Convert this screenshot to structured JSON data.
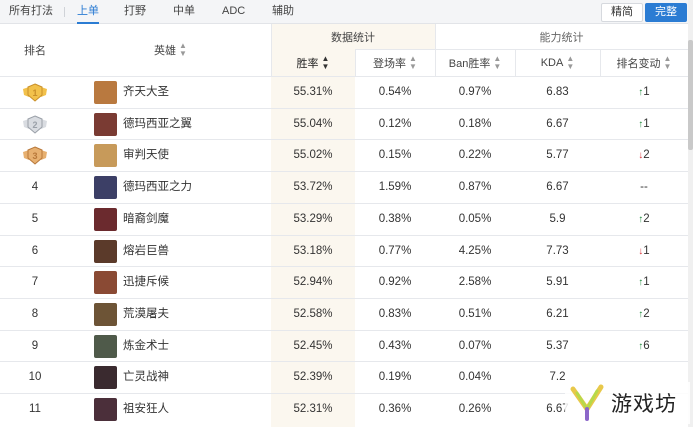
{
  "tabs": [
    {
      "label": "所有打法",
      "active": false
    },
    {
      "label": "上单",
      "active": true
    },
    {
      "label": "打野",
      "active": false
    },
    {
      "label": "中单",
      "active": false
    },
    {
      "label": "ADC",
      "active": false
    },
    {
      "label": "辅助",
      "active": false
    }
  ],
  "view_toggle": {
    "simple": "精简",
    "full": "完整",
    "selected": "完整"
  },
  "table": {
    "group_headers": {
      "data_stats": "数据统计",
      "ability_stats": "能力统计"
    },
    "columns": {
      "rank": "排名",
      "hero": "英雄",
      "winrate": "胜率",
      "pickrate": "登场率",
      "ban_winrate": "Ban胜率",
      "kda": "KDA",
      "rank_change": "排名变动"
    },
    "rows": [
      {
        "rank": "1",
        "medal": "gold-medal-icon",
        "hero": "齐天大圣",
        "avatar_color": "#b9793f",
        "winrate": "55.31%",
        "pickrate": "0.54%",
        "ban_winrate": "0.97%",
        "kda": "6.83",
        "change": "1",
        "direction": "up"
      },
      {
        "rank": "2",
        "medal": "silver-medal-icon",
        "hero": "德玛西亚之翼",
        "avatar_color": "#7a3b33",
        "winrate": "55.04%",
        "pickrate": "0.12%",
        "ban_winrate": "0.18%",
        "kda": "6.67",
        "change": "1",
        "direction": "up"
      },
      {
        "rank": "3",
        "medal": "bronze-medal-icon",
        "hero": "审判天使",
        "avatar_color": "#c79a5a",
        "winrate": "55.02%",
        "pickrate": "0.15%",
        "ban_winrate": "0.22%",
        "kda": "5.77",
        "change": "2",
        "direction": "down"
      },
      {
        "rank": "4",
        "medal": "",
        "hero": "德玛西亚之力",
        "avatar_color": "#3c3f66",
        "winrate": "53.72%",
        "pickrate": "1.59%",
        "ban_winrate": "0.87%",
        "kda": "6.67",
        "change": "--",
        "direction": "none"
      },
      {
        "rank": "5",
        "medal": "",
        "hero": "暗裔剑魔",
        "avatar_color": "#6b2a2e",
        "winrate": "53.29%",
        "pickrate": "0.38%",
        "ban_winrate": "0.05%",
        "kda": "5.9",
        "change": "2",
        "direction": "up"
      },
      {
        "rank": "6",
        "medal": "",
        "hero": "熔岩巨兽",
        "avatar_color": "#5b3a2a",
        "winrate": "53.18%",
        "pickrate": "0.77%",
        "ban_winrate": "4.25%",
        "kda": "7.73",
        "change": "1",
        "direction": "down"
      },
      {
        "rank": "7",
        "medal": "",
        "hero": "迅捷斥候",
        "avatar_color": "#8a4a34",
        "winrate": "52.94%",
        "pickrate": "0.92%",
        "ban_winrate": "2.58%",
        "kda": "5.91",
        "change": "1",
        "direction": "up"
      },
      {
        "rank": "8",
        "medal": "",
        "hero": "荒漠屠夫",
        "avatar_color": "#6d5436",
        "winrate": "52.58%",
        "pickrate": "0.83%",
        "ban_winrate": "0.51%",
        "kda": "6.21",
        "change": "2",
        "direction": "up"
      },
      {
        "rank": "9",
        "medal": "",
        "hero": "炼金术士",
        "avatar_color": "#4f5a4a",
        "winrate": "52.45%",
        "pickrate": "0.43%",
        "ban_winrate": "0.07%",
        "kda": "5.37",
        "change": "6",
        "direction": "up"
      },
      {
        "rank": "10",
        "medal": "",
        "hero": "亡灵战神",
        "avatar_color": "#3a2a2f",
        "winrate": "52.39%",
        "pickrate": "0.19%",
        "ban_winrate": "0.04%",
        "kda": "7.2",
        "change": "",
        "direction": "none"
      },
      {
        "rank": "11",
        "medal": "",
        "hero": "祖安狂人",
        "avatar_color": "#4b2f3a",
        "winrate": "52.31%",
        "pickrate": "0.36%",
        "ban_winrate": "0.26%",
        "kda": "6.67",
        "change": "",
        "direction": "none"
      }
    ]
  },
  "watermark": {
    "text": "游戏坊",
    "logo": "game-site-logo-icon"
  },
  "colors": {
    "accent": "#2b7cd3",
    "highlight": "#fbf7ef",
    "up": "#1f8a3c",
    "down": "#d9343a"
  }
}
